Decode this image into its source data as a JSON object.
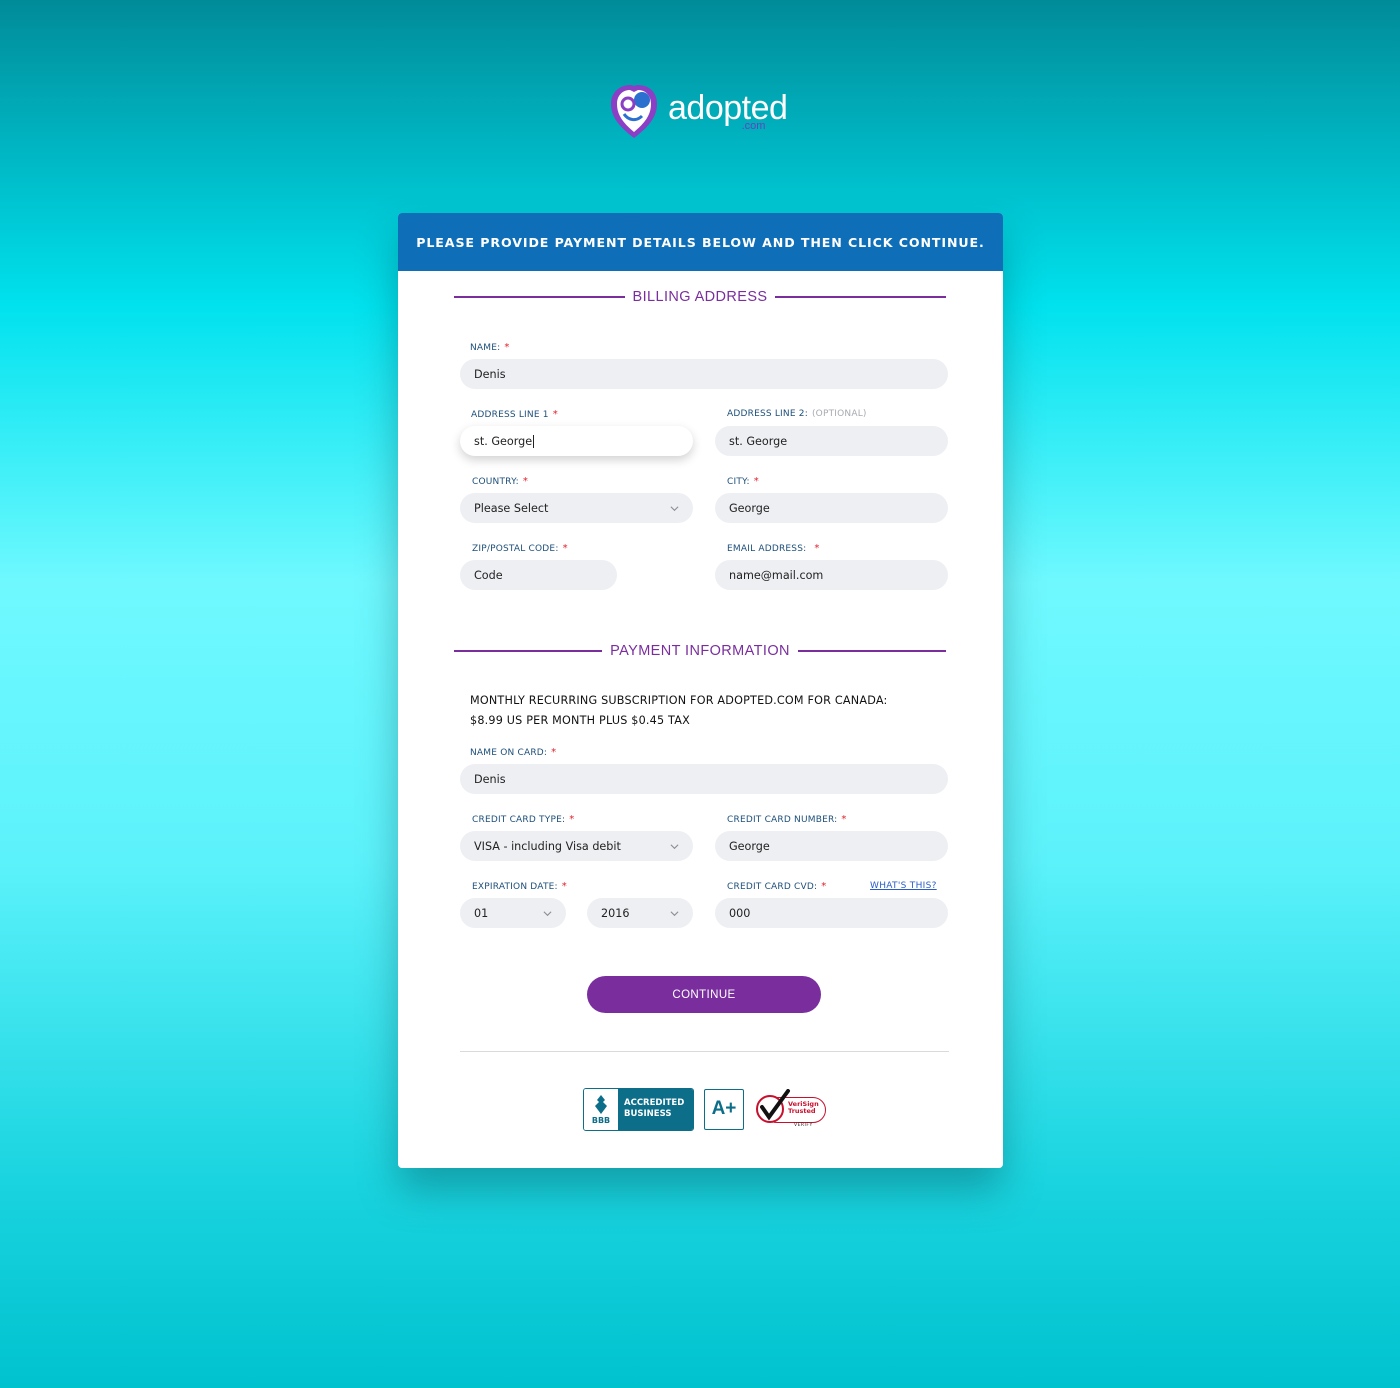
{
  "brand": {
    "name": "adopted",
    "suffix": ".com"
  },
  "header": {
    "title": "PLEASE PROVIDE PAYMENT DETAILS BELOW AND THEN CLICK CONTINUE."
  },
  "billing": {
    "title": "BILLING ADDRESS",
    "name_label": "NAME:",
    "name_value": "Denis",
    "address1_label": "ADDRESS LINE 1",
    "address1_value": "st. George",
    "address2_label": "ADDRESS LINE 2:",
    "address2_optional": "(OPTIONAL)",
    "address2_value": "st. George",
    "country_label": "COUNTRY:",
    "country_value": "Please Select",
    "city_label": "CITY:",
    "city_value": "George",
    "zip_label": "ZIP/POSTAL CODE:",
    "zip_value": "Code",
    "email_label": "EMAIL ADDRESS:",
    "email_value": "name@mail.com",
    "required_mark": "*"
  },
  "payment": {
    "title": "PAYMENT INFORMATION",
    "subscription_line1": "MONTHLY RECURRING SUBSCRIPTION FOR ADOPTED.COM FOR CANADA:",
    "subscription_line2": "$8.99 US PER MONTH PLUS $0.45 TAX",
    "name_on_card_label": "NAME ON CARD:",
    "name_on_card_value": "Denis",
    "card_type_label": "CREDIT CARD TYPE:",
    "card_type_value": "VISA - including Visa debit",
    "card_number_label": "CREDIT CARD NUMBER:",
    "card_number_value": "George",
    "expiration_label": "EXPIRATION DATE:",
    "exp_month_value": "01",
    "exp_year_value": "2016",
    "cvd_label": "CREDIT CARD CVD:",
    "cvd_help_link": "WHAT'S THIS?",
    "cvd_value": "000",
    "required_mark": "*"
  },
  "actions": {
    "continue_label": "CONTINUE"
  },
  "badges": {
    "bbb_mark": "BBB",
    "bbb_line1": "ACCREDITED",
    "bbb_line2": "BUSINESS",
    "rating": "A+",
    "verisign_line1": "VeriSign",
    "verisign_line2": "Trusted",
    "verisign_verify": "VERIFY"
  },
  "colors": {
    "header_blue": "#0e6fb8",
    "accent_purple": "#7a2e9e",
    "required_red": "#e0202a",
    "field_bg": "#eeeff3"
  }
}
